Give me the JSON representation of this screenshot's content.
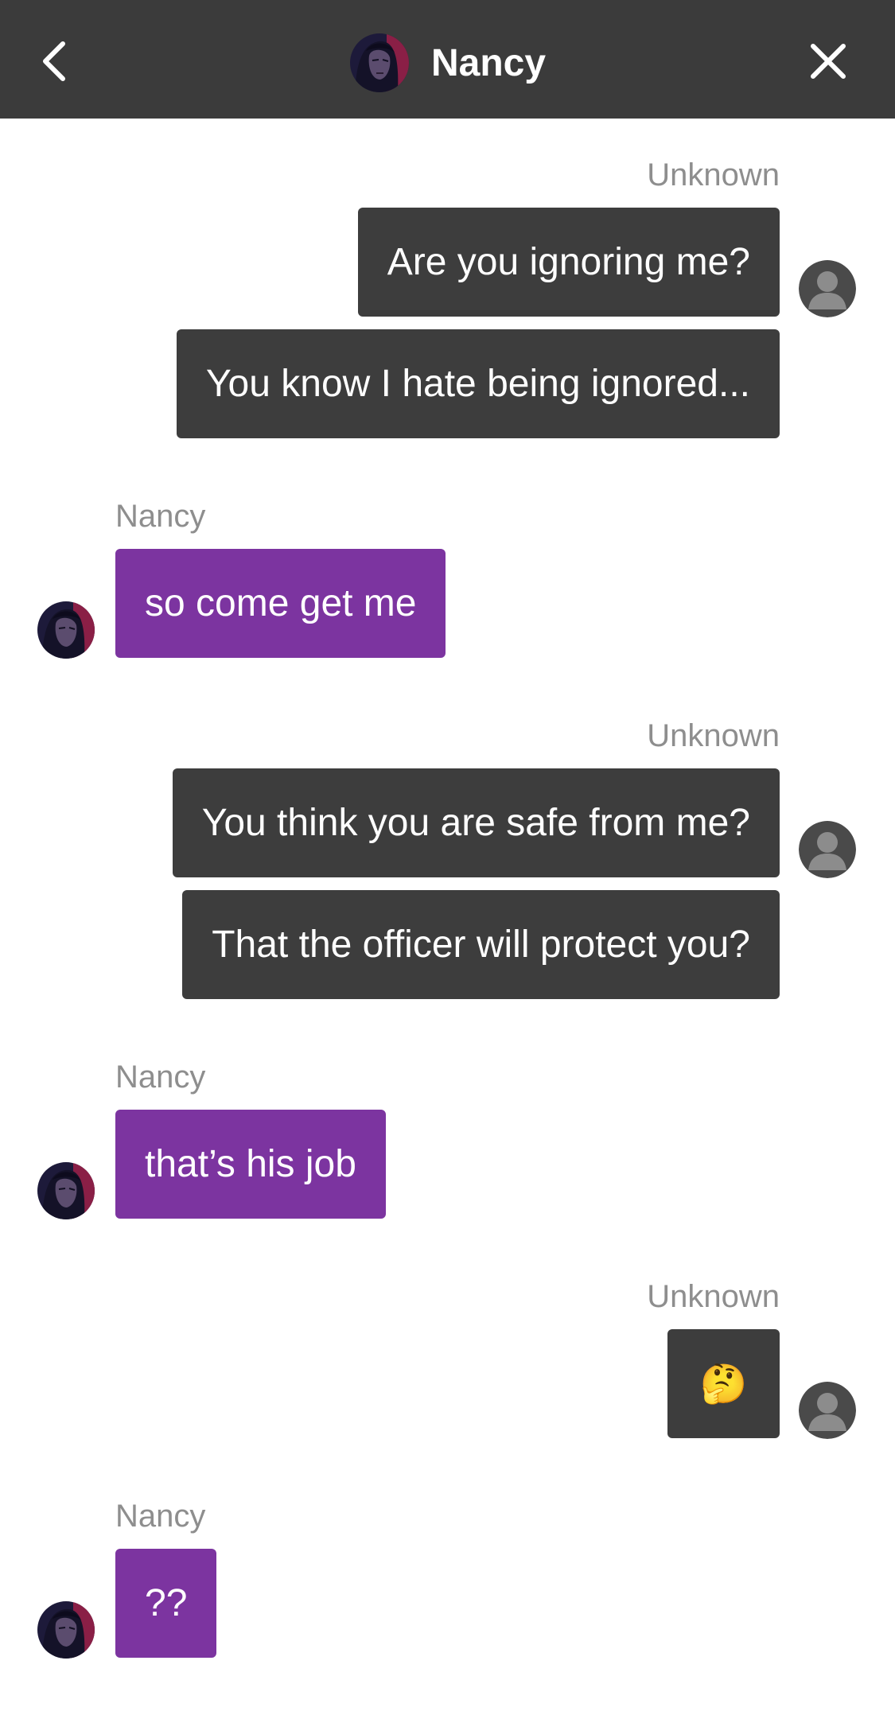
{
  "header": {
    "contact_name": "Nancy",
    "back_icon": "chevron-left-icon",
    "close_icon": "close-icon"
  },
  "colors": {
    "header_bg": "#3b3b3b",
    "outgoing_bubble": "#3d3d3d",
    "incoming_bubble": "#7c34a0",
    "sender_label": "#8e8e8e"
  },
  "messages": [
    {
      "sender": "Unknown",
      "text": "Are you ignoring me?"
    },
    {
      "sender": "Unknown",
      "text": "You know I hate being ignored..."
    },
    {
      "sender": "Nancy",
      "text": "so come get me"
    },
    {
      "sender": "Unknown",
      "text": "You think you are safe from me?"
    },
    {
      "sender": "Unknown",
      "text": "That the officer will protect you?"
    },
    {
      "sender": "Nancy",
      "text": "that’s his job"
    },
    {
      "sender": "Unknown",
      "text": "🤔"
    },
    {
      "sender": "Nancy",
      "text": "??"
    }
  ]
}
